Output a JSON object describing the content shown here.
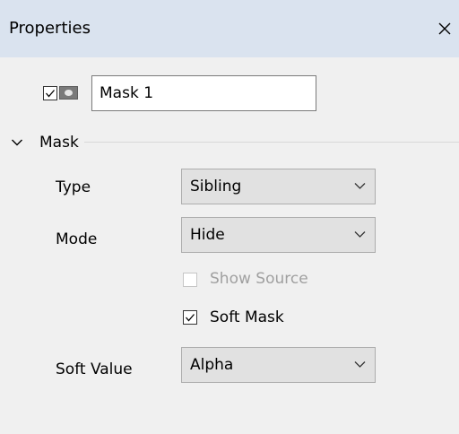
{
  "panel": {
    "title": "Properties",
    "close_symbol": "✕",
    "close_icon": "close-icon"
  },
  "layer": {
    "visible_checked": true,
    "thumbnail_icon": "mask-thumbnail-icon",
    "name_value": "Mask 1"
  },
  "mask_section": {
    "title": "Mask",
    "expanded": true,
    "expand_icon": "chevron-down-icon",
    "type": {
      "label": "Type",
      "value": "Sibling"
    },
    "mode": {
      "label": "Mode",
      "value": "Hide"
    },
    "show_source": {
      "label": "Show Source",
      "checked": false,
      "enabled": false
    },
    "soft_mask": {
      "label": "Soft Mask",
      "checked": true,
      "enabled": true
    },
    "soft_value": {
      "label": "Soft Value",
      "value": "Alpha"
    }
  },
  "colors": {
    "title_bar": "#dae3ef",
    "panel_bg": "#f0f0f0",
    "dropdown_bg": "#e1e1e1",
    "disabled_text": "#a0a0a0"
  }
}
